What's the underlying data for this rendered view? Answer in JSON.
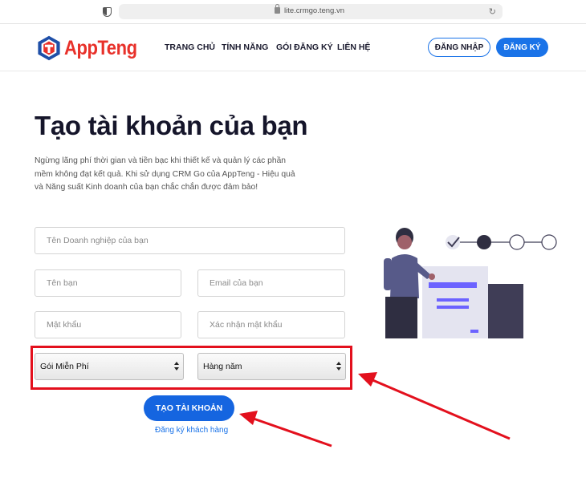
{
  "browser": {
    "url": "lite.crmgo.teng.vn"
  },
  "header": {
    "logo_text": "AppTeng",
    "nav": [
      {
        "label": "TRANG CHỦ"
      },
      {
        "label": "TÍNH NĂNG"
      },
      {
        "label": "GÓI ĐĂNG KÝ"
      },
      {
        "label": "LIÊN HỆ"
      }
    ],
    "login_label": "ĐĂNG NHẬP",
    "signup_label": "ĐĂNG KÝ"
  },
  "main": {
    "title": "Tạo tài khoản của bạn",
    "description": "Ngừng lãng phí thời gian và tiền bạc khi thiết kế và quản lý các phần mềm không đạt kết quả. Khi sử dụng CRM Go của AppTeng - Hiệu quả và Năng suất Kinh doanh của bạn chắc chắn được đảm bảo!"
  },
  "form": {
    "business_placeholder": "Tên Doanh nghiệp của bạn",
    "name_placeholder": "Tên bạn",
    "email_placeholder": "Email của bạn",
    "password_placeholder": "Mật khẩu",
    "confirm_placeholder": "Xác nhận mật khẩu",
    "plan_select": "Gói Miễn Phí",
    "cycle_select": "Hàng năm",
    "submit_label": "TẠO TÀI KHOẢN",
    "customer_link": "Đăng ký khách hàng"
  },
  "colors": {
    "brand_red": "#e8312a",
    "primary_blue": "#1a73e8",
    "annotation_red": "#e3101d"
  }
}
